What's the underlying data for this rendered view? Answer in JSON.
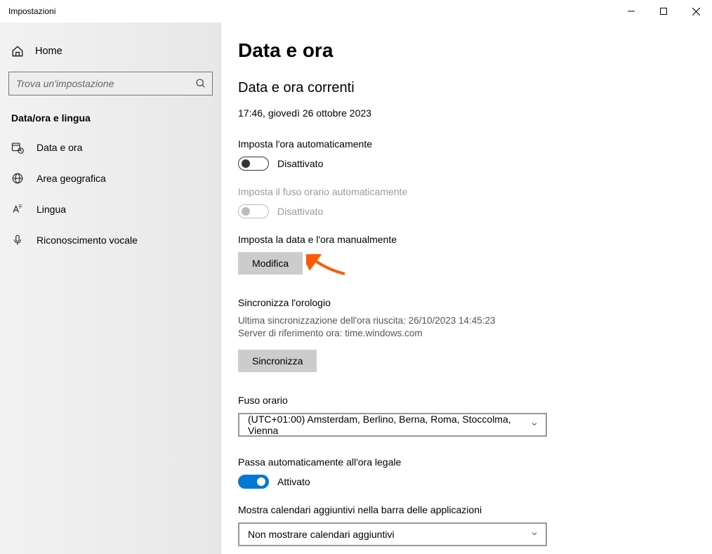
{
  "titlebar": {
    "title": "Impostazioni"
  },
  "sidebar": {
    "home": "Home",
    "search_placeholder": "Trova un'impostazione",
    "section": "Data/ora e lingua",
    "items": [
      {
        "label": "Data e ora"
      },
      {
        "label": "Area geografica"
      },
      {
        "label": "Lingua"
      },
      {
        "label": "Riconoscimento vocale"
      }
    ]
  },
  "main": {
    "page_title": "Data e ora",
    "current_heading": "Data e ora correnti",
    "current_datetime": "17:46, giovedì 26 ottobre 2023",
    "auto_time_label": "Imposta l'ora automaticamente",
    "auto_time_state": "Disattivato",
    "auto_tz_label": "Imposta il fuso orario automaticamente",
    "auto_tz_state": "Disattivato",
    "manual_label": "Imposta la data e l'ora manualmente",
    "modify_btn": "Modifica",
    "sync_heading": "Sincronizza l'orologio",
    "sync_last": "Ultima sincronizzazione dell'ora riuscita: 26/10/2023 14:45:23",
    "sync_server": "Server di riferimento ora: time.windows.com",
    "sync_btn": "Sincronizza",
    "tz_heading": "Fuso orario",
    "tz_value": "(UTC+01:00) Amsterdam, Berlino, Berna, Roma, Stoccolma, Vienna",
    "dst_label": "Passa automaticamente all'ora legale",
    "dst_state": "Attivato",
    "calendars_label": "Mostra calendari aggiuntivi nella barra delle applicazioni",
    "calendars_value": "Non mostrare calendari aggiuntivi"
  }
}
